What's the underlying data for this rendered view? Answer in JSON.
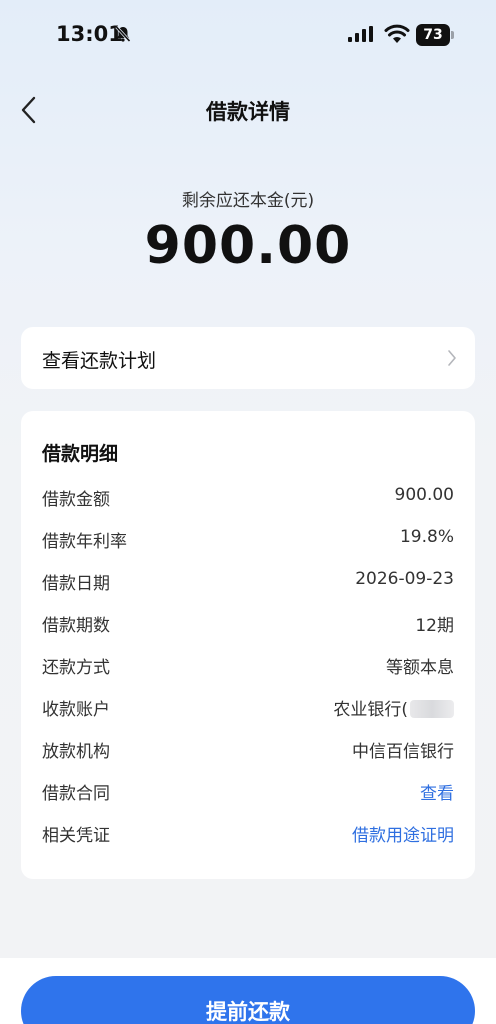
{
  "status_bar": {
    "time": "13:01",
    "battery": "73"
  },
  "nav": {
    "title": "借款详情"
  },
  "summary": {
    "label": "剩余应还本金(元)",
    "amount": "900.00"
  },
  "schedule": {
    "label": "查看还款计划"
  },
  "details": {
    "title": "借款明细",
    "rows": [
      {
        "label": "借款金额",
        "value": "900.00"
      },
      {
        "label": "借款年利率",
        "value": "19.8%"
      },
      {
        "label": "借款日期",
        "value": "2026-09-23"
      },
      {
        "label": "借款期数",
        "value": "12期"
      },
      {
        "label": "还款方式",
        "value": "等额本息"
      },
      {
        "label": "收款账户",
        "value": "农业银行("
      },
      {
        "label": "放款机构",
        "value": "中信百信银行"
      },
      {
        "label": "借款合同",
        "value": "查看"
      },
      {
        "label": "相关凭证",
        "value": "借款用途证明"
      }
    ],
    "link_color": "#2f6fe0"
  },
  "actions": {
    "prepay_label": "提前还款",
    "accent": "#2f74ec"
  }
}
